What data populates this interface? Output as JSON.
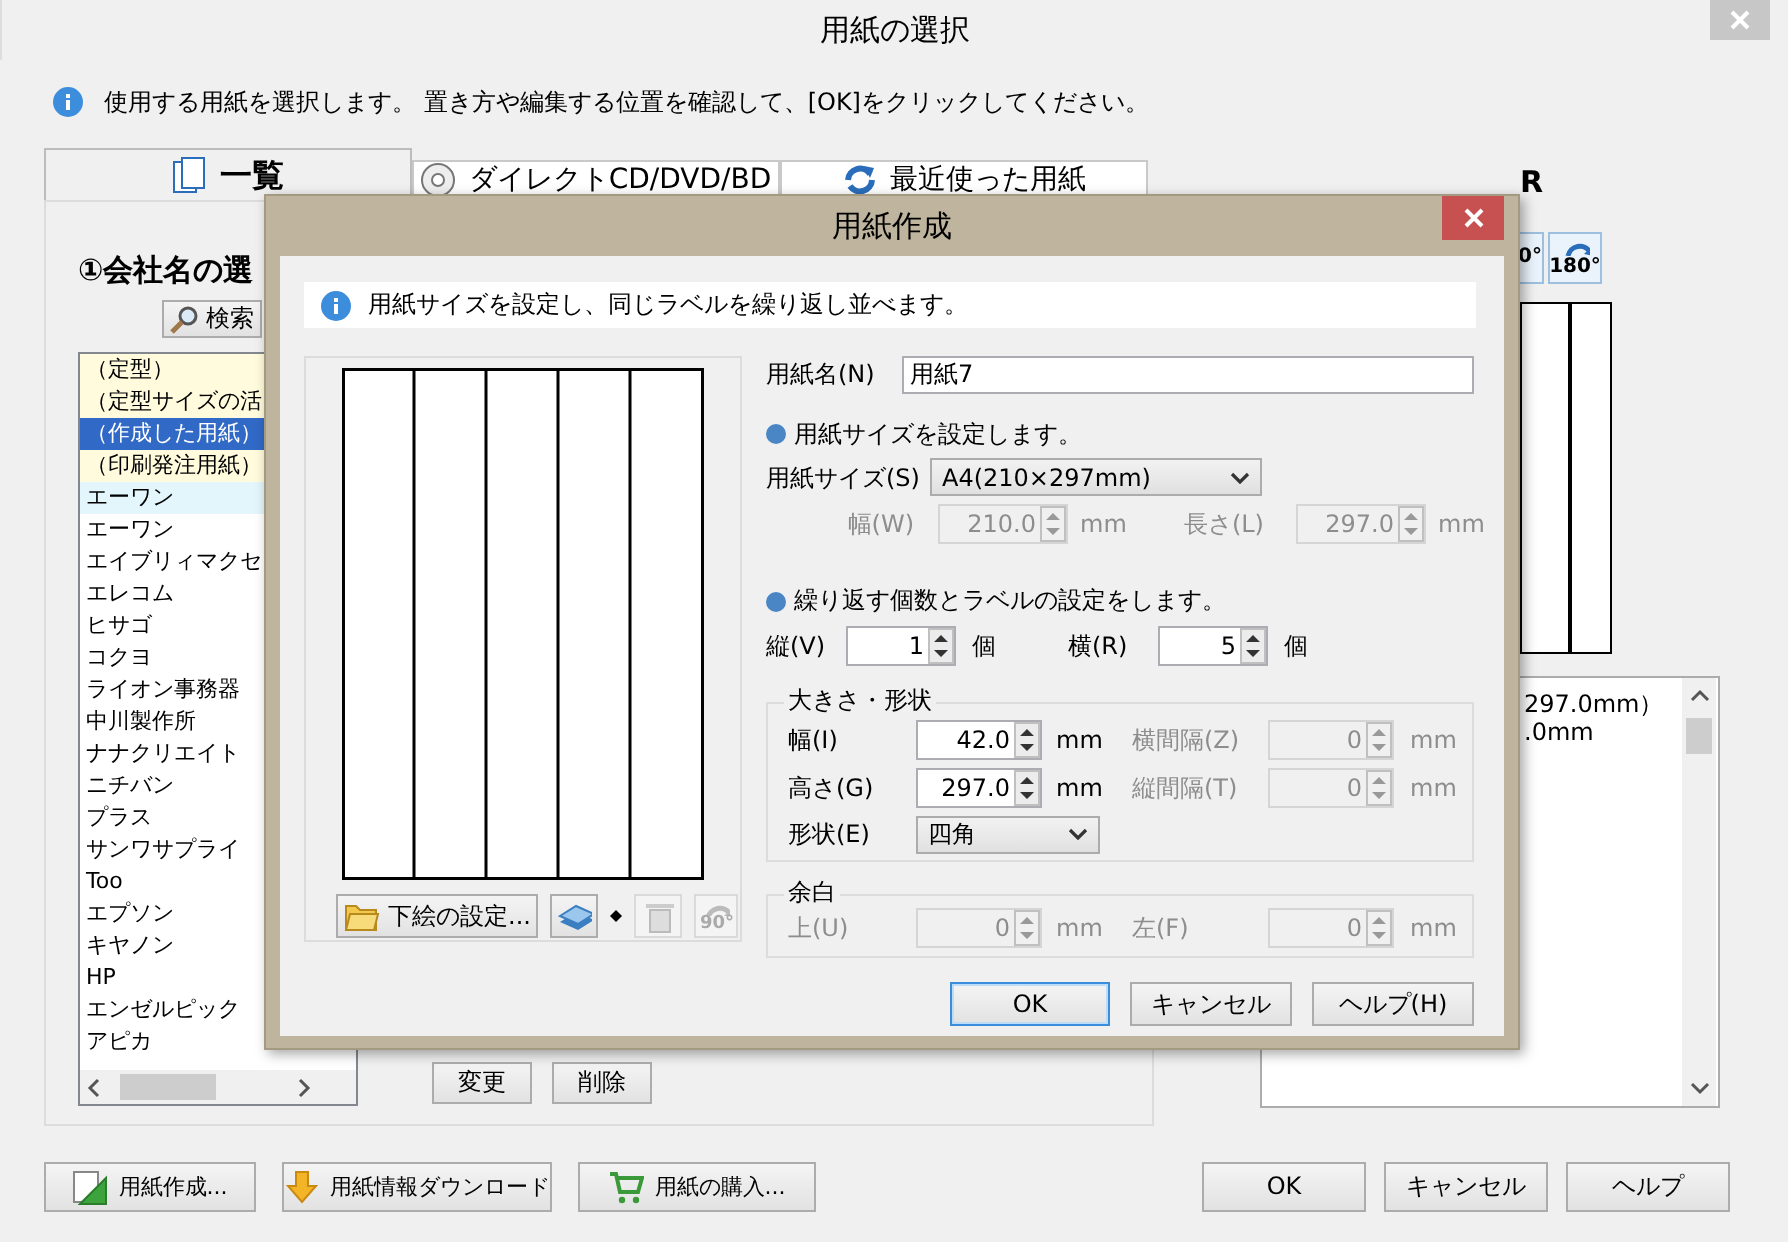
{
  "window": {
    "title": "用紙の選択"
  },
  "info": "使用する用紙を選択します。 置き方や編集する位置を確認して、[OK]をクリックしてください。",
  "tabs": [
    {
      "label": "一覧",
      "selected": true,
      "kind": "list"
    },
    {
      "label": "ダイレクトCD/DVD/BD",
      "selected": false,
      "kind": "disc"
    },
    {
      "label": "最近使った用紙",
      "selected": false,
      "kind": "recent"
    }
  ],
  "list_panel": {
    "heading": "①会社名の選",
    "search_button": "検索",
    "items": [
      {
        "label": "（定型）",
        "kind": "category",
        "selected": false
      },
      {
        "label": "（定型サイズの活",
        "kind": "category",
        "selected": false
      },
      {
        "label": "（作成した用紙）",
        "kind": "category",
        "selected": true
      },
      {
        "label": "（印刷発注用紙）",
        "kind": "category",
        "selected": false
      },
      {
        "label": "エーワン",
        "kind": "featured",
        "selected": false
      },
      {
        "label": "エーワン",
        "kind": "company",
        "selected": false
      },
      {
        "label": "エイブリィマクセ",
        "kind": "company",
        "selected": false
      },
      {
        "label": "エレコム",
        "kind": "company",
        "selected": false
      },
      {
        "label": "ヒサゴ",
        "kind": "company",
        "selected": false
      },
      {
        "label": "コクヨ",
        "kind": "company",
        "selected": false
      },
      {
        "label": "ライオン事務器",
        "kind": "company",
        "selected": false
      },
      {
        "label": "中川製作所",
        "kind": "company",
        "selected": false
      },
      {
        "label": "ナナクリエイト",
        "kind": "company",
        "selected": false
      },
      {
        "label": "ニチバン",
        "kind": "company",
        "selected": false
      },
      {
        "label": "プラス",
        "kind": "company",
        "selected": false
      },
      {
        "label": "サンワサプライ",
        "kind": "company",
        "selected": false
      },
      {
        "label": "Too",
        "kind": "company",
        "selected": false
      },
      {
        "label": "エプソン",
        "kind": "company",
        "selected": false
      },
      {
        "label": "キヤノン",
        "kind": "company",
        "selected": false
      },
      {
        "label": "HP",
        "kind": "company",
        "selected": false
      },
      {
        "label": "エンゼルピック",
        "kind": "company",
        "selected": false
      },
      {
        "label": "アピカ",
        "kind": "company",
        "selected": false
      }
    ],
    "buttons": [
      "変更",
      "削除"
    ]
  },
  "preview_panel": {
    "title": "R",
    "rotate_buttons": [
      {
        "label": "0°",
        "kind": "plain"
      },
      {
        "label": "180°",
        "kind": "rotate"
      }
    ],
    "details": [
      "297.0mm）",
      ".0mm"
    ]
  },
  "footer_buttons": [
    {
      "label": "用紙作成...",
      "kind": "create"
    },
    {
      "label": "用紙情報ダウンロード",
      "kind": "download"
    },
    {
      "label": "用紙の購入...",
      "kind": "buy"
    }
  ],
  "footer_right": [
    "OK",
    "キャンセル",
    "ヘルプ"
  ],
  "dialog": {
    "title": "用紙作成",
    "info": "用紙サイズを設定し、同じラベルを繰り返し並べます。",
    "preview_buttons": [
      {
        "kind": "background",
        "label": "下絵の設定...",
        "disabled": false
      },
      {
        "kind": "layers",
        "disabled": false
      },
      {
        "kind": "delete",
        "disabled": true
      },
      {
        "kind": "rotate",
        "label": "90°",
        "disabled": true
      }
    ],
    "name_field": {
      "label": "用紙名(N)",
      "value": "用紙7"
    },
    "size_section": {
      "heading": "用紙サイズを設定します。",
      "size_select": {
        "label": "用紙サイズ(S)",
        "value": "A4(210×297mm)"
      },
      "fields": [
        {
          "label": "幅(W)",
          "value": "210.0",
          "unit": "mm",
          "disabled": true
        },
        {
          "label": "長さ(L)",
          "value": "297.0",
          "unit": "mm",
          "disabled": true
        }
      ]
    },
    "repeat_section": {
      "heading": "繰り返す個数とラベルの設定をします。",
      "fields": [
        {
          "label": "縦(V)",
          "value": "1",
          "unit": "個",
          "disabled": false
        },
        {
          "label": "横(R)",
          "value": "5",
          "unit": "個",
          "disabled": false
        }
      ]
    },
    "shape_group": {
      "legend": "大きさ・形状",
      "fields": [
        {
          "label": "幅(I)",
          "value": "42.0",
          "unit": "mm",
          "disabled": false
        },
        {
          "label": "横間隔(Z)",
          "value": "0",
          "unit": "mm",
          "disabled": true
        },
        {
          "label": "高さ(G)",
          "value": "297.0",
          "unit": "mm",
          "disabled": false
        },
        {
          "label": "縦間隔(T)",
          "value": "0",
          "unit": "mm",
          "disabled": true
        }
      ],
      "shape_select": {
        "label": "形状(E)",
        "value": "四角"
      }
    },
    "margin_group": {
      "legend": "余白",
      "fields": [
        {
          "label": "上(U)",
          "value": "0",
          "unit": "mm",
          "disabled": true
        },
        {
          "label": "左(F)",
          "value": "0",
          "unit": "mm",
          "disabled": true
        }
      ]
    },
    "buttons": [
      {
        "label": "OK",
        "default": true
      },
      {
        "label": "キャンセル",
        "default": false
      },
      {
        "label": "ヘルプ(H)",
        "default": false
      }
    ]
  }
}
